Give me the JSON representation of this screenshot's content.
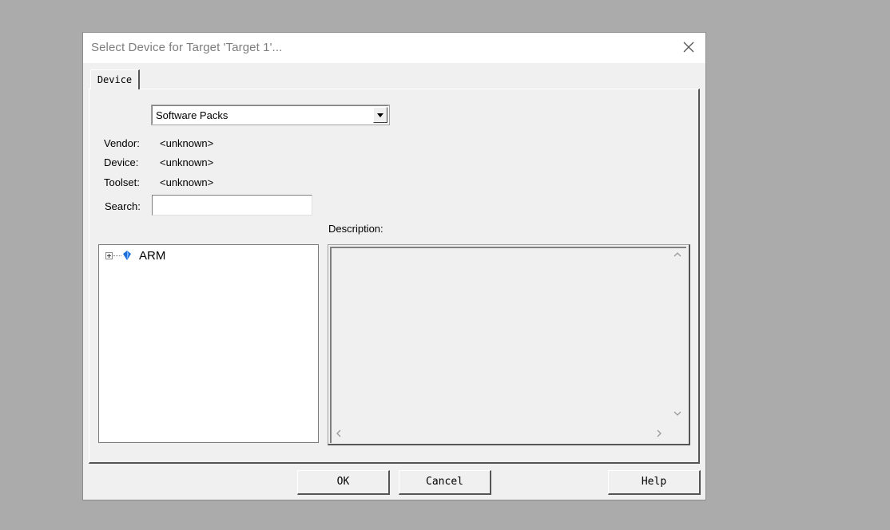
{
  "dialog": {
    "title": "Select Device for Target 'Target 1'...",
    "close_icon": "close-icon"
  },
  "tabs": [
    {
      "label": "Device",
      "active": true
    }
  ],
  "device_panel": {
    "source_select": {
      "value": "Software Packs"
    },
    "info": [
      {
        "label": "Vendor:",
        "value": "<unknown>"
      },
      {
        "label": "Device:",
        "value": "<unknown>"
      },
      {
        "label": "Toolset:",
        "value": "<unknown>"
      }
    ],
    "search": {
      "label": "Search:",
      "value": "",
      "placeholder": ""
    },
    "tree": [
      {
        "label": "ARM",
        "expanded": false,
        "icon": "gem-icon"
      }
    ],
    "description": {
      "label": "Description:",
      "text": ""
    }
  },
  "buttons": {
    "ok": "OK",
    "cancel": "Cancel",
    "help": "Help"
  },
  "colors": {
    "desktop": "#ababab",
    "dialog_bg": "#f0f0f0",
    "title_text": "#7d7d7d",
    "gem": "#1e6fd9"
  }
}
